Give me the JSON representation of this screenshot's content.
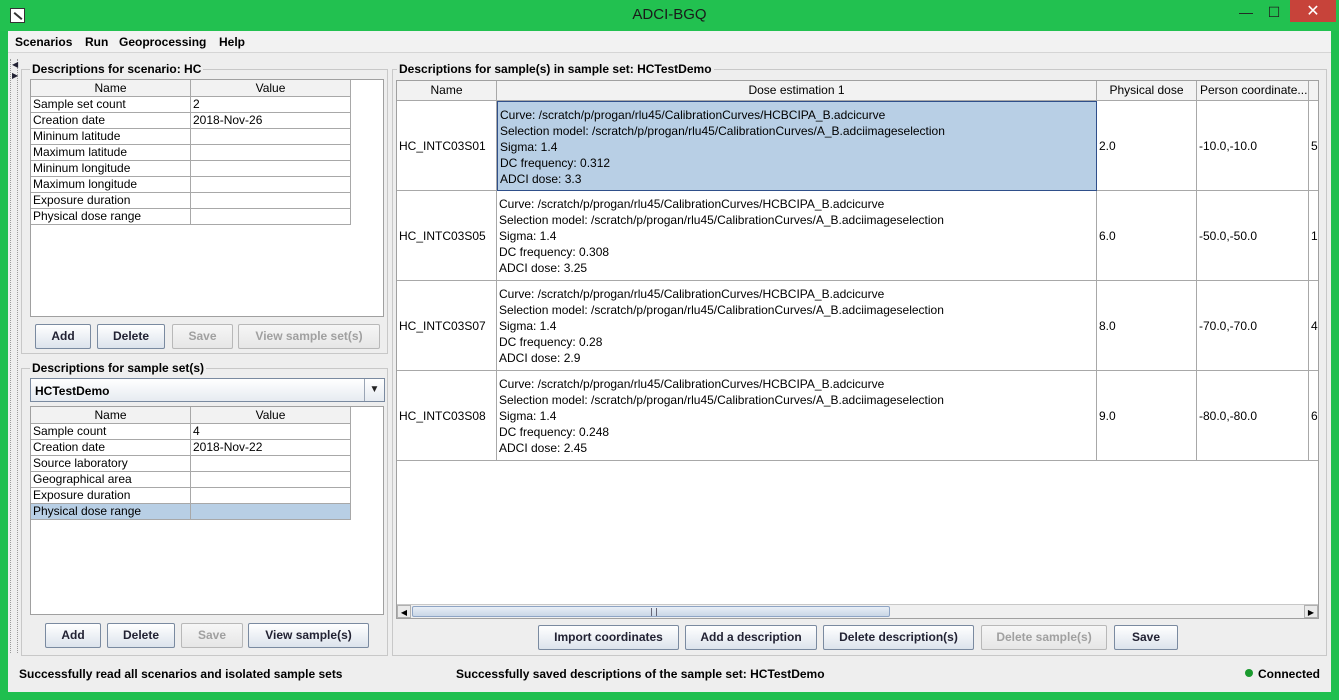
{
  "window": {
    "title": "ADCI-BGQ"
  },
  "menu": [
    "Scenarios",
    "Run",
    "Geoprocessing",
    "Help"
  ],
  "scenario_panel": {
    "title": "Descriptions for scenario: HC",
    "columns": [
      "Name",
      "Value"
    ],
    "rows": [
      [
        "Sample set count",
        "2"
      ],
      [
        "Creation date",
        "2018-Nov-26"
      ],
      [
        "Mininum latitude",
        ""
      ],
      [
        "Maximum latitude",
        ""
      ],
      [
        "Mininum longitude",
        ""
      ],
      [
        "Maximum longitude",
        ""
      ],
      [
        "Exposure duration",
        ""
      ],
      [
        "Physical dose range",
        ""
      ]
    ],
    "buttons": {
      "add": "Add",
      "delete": "Delete",
      "save": "Save",
      "view": "View sample set(s)"
    }
  },
  "sampleset_panel": {
    "title": "Descriptions for sample set(s)",
    "selected": "HCTestDemo",
    "columns": [
      "Name",
      "Value"
    ],
    "rows": [
      [
        "Sample count",
        "4"
      ],
      [
        "Creation date",
        "2018-Nov-22"
      ],
      [
        "Source laboratory",
        ""
      ],
      [
        "Geographical area",
        ""
      ],
      [
        "Exposure duration",
        ""
      ],
      [
        "Physical dose range",
        ""
      ]
    ],
    "buttons": {
      "add": "Add",
      "delete": "Delete",
      "save": "Save",
      "view": "View sample(s)"
    }
  },
  "samples_panel": {
    "title": "Descriptions for sample(s) in sample set: HCTestDemo",
    "columns": [
      "Name",
      "Dose estimation 1",
      "Physical dose",
      "Person coordinate..."
    ],
    "rows": [
      {
        "name": "HC_INTC03S01",
        "dose": [
          "Curve: /scratch/p/progan/rlu45/CalibrationCurves/HCBCIPA_B.adcicurve",
          "Selection model: /scratch/p/progan/rlu45/CalibrationCurves/A_B.adciimageselection",
          "Sigma: 1.4",
          "DC frequency: 0.312",
          "ADCI dose: 3.3"
        ],
        "physical": "2.0",
        "coord": "-10.0,-10.0",
        "extra": "5"
      },
      {
        "name": "HC_INTC03S05",
        "dose": [
          "Curve: /scratch/p/progan/rlu45/CalibrationCurves/HCBCIPA_B.adcicurve",
          "Selection model: /scratch/p/progan/rlu45/CalibrationCurves/A_B.adciimageselection",
          "Sigma: 1.4",
          "DC frequency: 0.308",
          "ADCI dose: 3.25"
        ],
        "physical": "6.0",
        "coord": "-50.0,-50.0",
        "extra": "1"
      },
      {
        "name": "HC_INTC03S07",
        "dose": [
          "Curve: /scratch/p/progan/rlu45/CalibrationCurves/HCBCIPA_B.adcicurve",
          "Selection model: /scratch/p/progan/rlu45/CalibrationCurves/A_B.adciimageselection",
          "Sigma: 1.4",
          "DC frequency: 0.28",
          "ADCI dose: 2.9"
        ],
        "physical": "8.0",
        "coord": "-70.0,-70.0",
        "extra": "4"
      },
      {
        "name": "HC_INTC03S08",
        "dose": [
          "Curve: /scratch/p/progan/rlu45/CalibrationCurves/HCBCIPA_B.adcicurve",
          "Selection model: /scratch/p/progan/rlu45/CalibrationCurves/A_B.adciimageselection",
          "Sigma: 1.4",
          "DC frequency: 0.248",
          "ADCI dose: 2.45"
        ],
        "physical": "9.0",
        "coord": "-80.0,-80.0",
        "extra": "6"
      }
    ],
    "buttons": {
      "import": "Import coordinates",
      "add": "Add a description",
      "delete_desc": "Delete description(s)",
      "delete_samples": "Delete sample(s)",
      "save": "Save"
    }
  },
  "status": {
    "left": "Successfully read all scenarios and isolated sample sets",
    "middle": "Successfully saved descriptions of the sample set: HCTestDemo",
    "connection": "Connected"
  }
}
